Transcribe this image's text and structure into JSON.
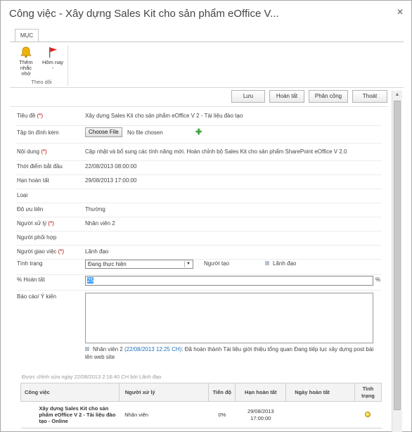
{
  "dialog": {
    "title": "Công việc - Xây dựng Sales Kit cho sản phẩm eOffice V...",
    "close_icon": "close-icon"
  },
  "ribbon": {
    "tab_label": "MỤC",
    "buttons": [
      {
        "label_line1": "Thêm nhắc",
        "label_line2": "nhở",
        "icon": "bell-icon"
      },
      {
        "label_line1": "Hôm nay",
        "label_line2": "-",
        "icon": "red-flag-icon"
      }
    ],
    "group_label": "Theo dõi"
  },
  "toolbar": {
    "save_label": "Lưu",
    "complete_label": "Hoàn tất",
    "assign_label": "Phân công",
    "exit_label": "Thoát"
  },
  "form": {
    "title_label": "Tiêu đề",
    "title_value": "Xây dựng Sales Kit cho sản phẩm eOffice V 2 - Tài liệu đào tạo",
    "attach_label": "Tập tin đính kèm",
    "attach_button": "Choose File",
    "attach_status": "No file chosen",
    "content_label": "Nội dung",
    "content_value": "Cập nhật và bổ sung các tính năng mới. Hoàn chỉnh bộ Sales Kit cho sản phẩm SharePoint eOffice V 2.0",
    "start_label": "Thời điểm bắt đầu",
    "start_value": "22/08/2013 08:00:00",
    "due_label": "Hạn hoàn tất",
    "due_value": "29/08/2013 17:00:00",
    "type_label": "Loại",
    "priority_label": "Độ ưu tiên",
    "priority_value": "Thường",
    "handler_label": "Người xử lý",
    "handler_value": "Nhân viên 2",
    "coordinator_label": "Người phối hợp",
    "assigner_label": "Người giao việc",
    "assigner_value": "Lãnh đạo",
    "status_label": "Tình trạng",
    "status_value": "Đang thực hiện",
    "creator_label": "Người tạo",
    "creator_value": "Lãnh đạo",
    "pct_label": "% Hoàn tất",
    "pct_value": "25",
    "pct_suffix": "%",
    "report_label": "Báo cáo/ Ý kiến",
    "required_mark": "(*)",
    "comment": {
      "author": "Nhân viên 2",
      "timestamp": "(22/08/2013 12:25 CH)",
      "text_line1": ": Đã hoàn thành Tài liệu giới thiệu tổng quan Đang tiếp tục xây dựng post bài",
      "text_line2": "lên web site"
    }
  },
  "footer_note": "Được chỉnh sửa ngày 22/08/2013 2:16:40 CH bởi Lãnh đạo",
  "grid": {
    "headers": [
      "Công việc",
      "Người xử lý",
      "Tiến độ",
      "Hạn hoàn tất",
      "Ngày hoàn tất",
      "Tình trạng"
    ],
    "rows": [
      {
        "task_line1": "Xây dựng Sales Kit cho sản",
        "task_line2": "phẩm eOffice V 2 - Tài liệu đào",
        "task_line3": "tạo - Online",
        "handler": "Nhân viên",
        "progress": "0%",
        "due_line1": "29/08/2013",
        "due_line2": "17:00:00",
        "done": "",
        "status_icon": "yellow-status-dot-icon"
      }
    ]
  },
  "colors": {
    "required": "#bf0000",
    "link": "#1f6fb8",
    "selection": "#3399ff",
    "plus": "#3aa13a"
  }
}
